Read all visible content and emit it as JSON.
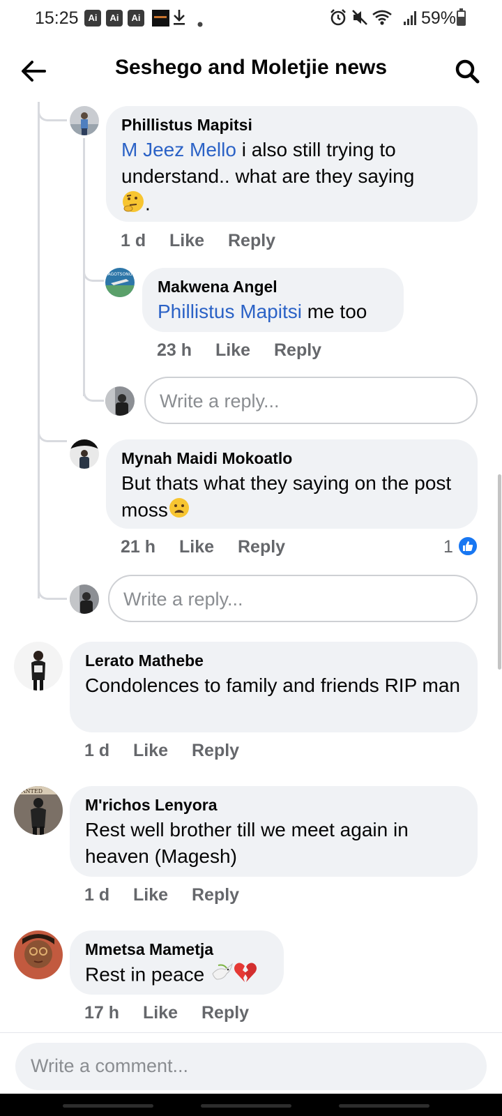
{
  "status_bar": {
    "time": "15:25",
    "app_badges": [
      "Ai",
      "Ai",
      "Ai"
    ],
    "battery": "59%",
    "battery_level": 0.59,
    "icons": [
      "alarm-icon",
      "mute-icon",
      "wifi-icon",
      "signal-icon"
    ]
  },
  "header": {
    "title": "Seshego and Moletjie news",
    "back_icon": "arrow-left-icon",
    "search_icon": "search-icon"
  },
  "comments": [
    {
      "author": "Phillistus Mapitsi",
      "mention": "M Jeez Mello",
      "text": " i also still trying to understand.. what are they saying",
      "text_tail": ".",
      "emoji": "thinking-face",
      "time": "1 d",
      "like": "Like",
      "reply": "Reply"
    },
    {
      "author": "Makwena Angel",
      "mention": "Phillistus Mapitsi",
      "text": " me too",
      "time": "23 h",
      "like": "Like",
      "reply": "Reply"
    },
    {
      "author": "Mynah Maidi Mokoatlo",
      "text": "But thats what they saying on the post moss",
      "emoji": "frowning-face",
      "time": "21 h",
      "like": "Like",
      "reply": "Reply",
      "reaction_count": "1",
      "reaction": "like"
    },
    {
      "author": "Lerato Mathebe",
      "text": "Condolences to family and friends RIP man",
      "time": "1 d",
      "like": "Like",
      "reply": "Reply"
    },
    {
      "author": "M'richos Lenyora",
      "text": "Rest well brother till we meet again in heaven (Magesh)",
      "time": "1 d",
      "like": "Like",
      "reply": "Reply"
    },
    {
      "author": "Mmetsa Mametja",
      "text": "Rest in peace",
      "emoji": [
        "dove",
        "broken-heart"
      ],
      "time": "17 h",
      "like": "Like",
      "reply": "Reply"
    }
  ],
  "reply_placeholder": "Write a reply...",
  "composer": {
    "placeholder": "Write a comment..."
  },
  "colors": {
    "bubble": "#f0f2f5",
    "mention": "#2b62c6",
    "meta": "#65676b",
    "like_reaction": "#1877f2"
  }
}
